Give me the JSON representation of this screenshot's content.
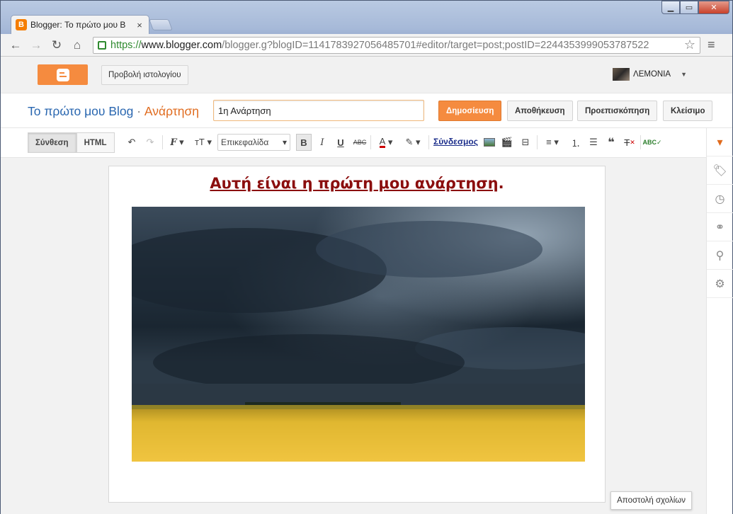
{
  "browser": {
    "tab_title": "Blogger: Το πρώτο μου Β",
    "tab_close": "×",
    "url_scheme": "https://",
    "url_host": "www.blogger.com",
    "url_path": "/blogger.g?blogID=1141783927056485701#editor/target=post;postID=2244353999053787522",
    "back_icon": "back-arrow-icon",
    "forward_icon": "forward-arrow-icon",
    "reload_icon": "reload-icon",
    "home_icon": "home-icon"
  },
  "header": {
    "view_blog_label": "Προβολή ιστολογίου",
    "user_name": "ΛΕΜΟΝΙΑ"
  },
  "post_bar": {
    "blog_name": "Το πρώτο μου Blog",
    "separator": "·",
    "section": "Ανάρτηση",
    "title_value": "1η Ανάρτηση",
    "publish_label": "Δημοσίευση",
    "save_label": "Αποθήκευση",
    "preview_label": "Προεπισκόπηση",
    "close_label": "Κλείσιμο"
  },
  "format_bar": {
    "compose_label": "Σύνθεση",
    "html_label": "HTML",
    "heading_select": "Επικεφαλίδα",
    "bold": "B",
    "italic": "I",
    "underline": "U",
    "strike": "ABC",
    "link_label": "Σύνδεσμος"
  },
  "editor": {
    "heading_text": "Αυτή είναι η πρώτη μου ανάρτηση",
    "heading_punct": "."
  },
  "footer": {
    "send_feedback": "Αποστολή σχολίων"
  },
  "colors": {
    "accent": "#f58b3f",
    "heading": "#8b0e0e",
    "link_blue": "#2a67b0"
  }
}
